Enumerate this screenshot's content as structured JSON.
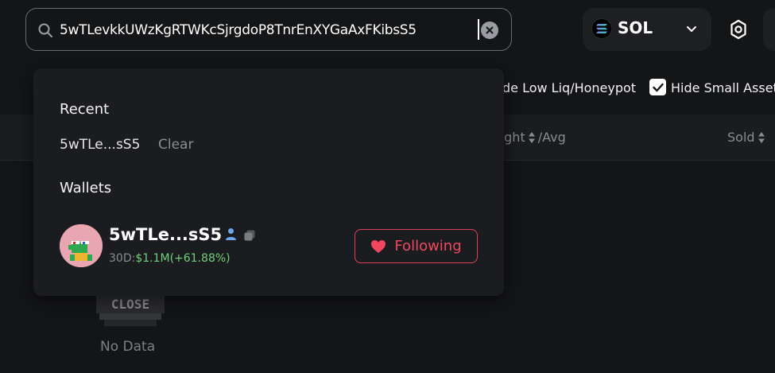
{
  "search": {
    "value": "5wTLevkkUWzKgRTWKcSjrgdoP8TnrEnXYGaAxFKibsS5"
  },
  "chain": {
    "label": "SOL"
  },
  "filters": {
    "low_liq_label": "de Low Liq/Honeypot",
    "hide_small_label": "Hide Small Asset",
    "hide_small_checked": true
  },
  "table": {
    "headers": {
      "bought": "ught",
      "bought_suffix": "/Avg",
      "sold": "Sold"
    },
    "empty_text": "No Data",
    "empty_art_text": "CLOSE"
  },
  "dropdown": {
    "recent_heading": "Recent",
    "recent_items": [
      "5wTLe...sS5"
    ],
    "clear_label": "Clear",
    "wallets_heading": "Wallets",
    "wallet": {
      "name": "5wTLe...sS5",
      "pnl_prefix": "30D:",
      "pnl_amount": "$1.1M",
      "pnl_change": "(+61.88%)",
      "follow_label": "Following"
    }
  },
  "colors": {
    "accent_red": "#e0405a",
    "positive_green": "#6fd07a",
    "background": "#141517",
    "panel": "#1b1c1f"
  },
  "icons": [
    "search-icon",
    "clear-icon",
    "solana-icon",
    "chevron-down-icon",
    "settings-icon",
    "check-icon",
    "sort-icon",
    "user-icon",
    "copy-icon",
    "heart-icon"
  ]
}
